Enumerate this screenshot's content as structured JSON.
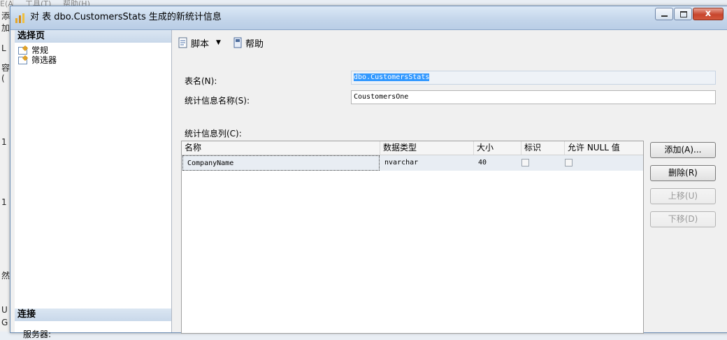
{
  "background": {
    "menu": [
      "E(A)",
      "工具(T)",
      "帮助(H)"
    ],
    "fragments": [
      "添加",
      "L",
      "容(",
      "1",
      "1",
      "然",
      "U",
      "G"
    ]
  },
  "window": {
    "title": "对 表 dbo.CustomersStats 生成的新统计信息",
    "close_glyph": "x"
  },
  "left_pane": {
    "pages_header": "选择页",
    "pages": [
      "常规",
      "筛选器"
    ],
    "connection_header": "连接",
    "server_label": "服务器:"
  },
  "toolbar": {
    "script_label": "脚本",
    "dropdown_glyph": "▼",
    "help_label": "帮助"
  },
  "form": {
    "table_name_label": "表名(N):",
    "table_name_value": "dbo.CustomersStats",
    "stats_name_label": "统计信息名称(S):",
    "stats_name_value": "CoustomersOne",
    "columns_label": "统计信息列(C):"
  },
  "grid": {
    "headers": [
      "名称",
      "数据类型",
      "大小",
      "标识",
      "允许 NULL 值"
    ],
    "rows": [
      {
        "name": "CompanyName",
        "type": "nvarchar",
        "size": "40",
        "identity": false,
        "nullable": false
      }
    ]
  },
  "buttons": {
    "add": "添加(A)...",
    "delete": "删除(R)",
    "move_up": "上移(U)",
    "move_down": "下移(D)"
  }
}
